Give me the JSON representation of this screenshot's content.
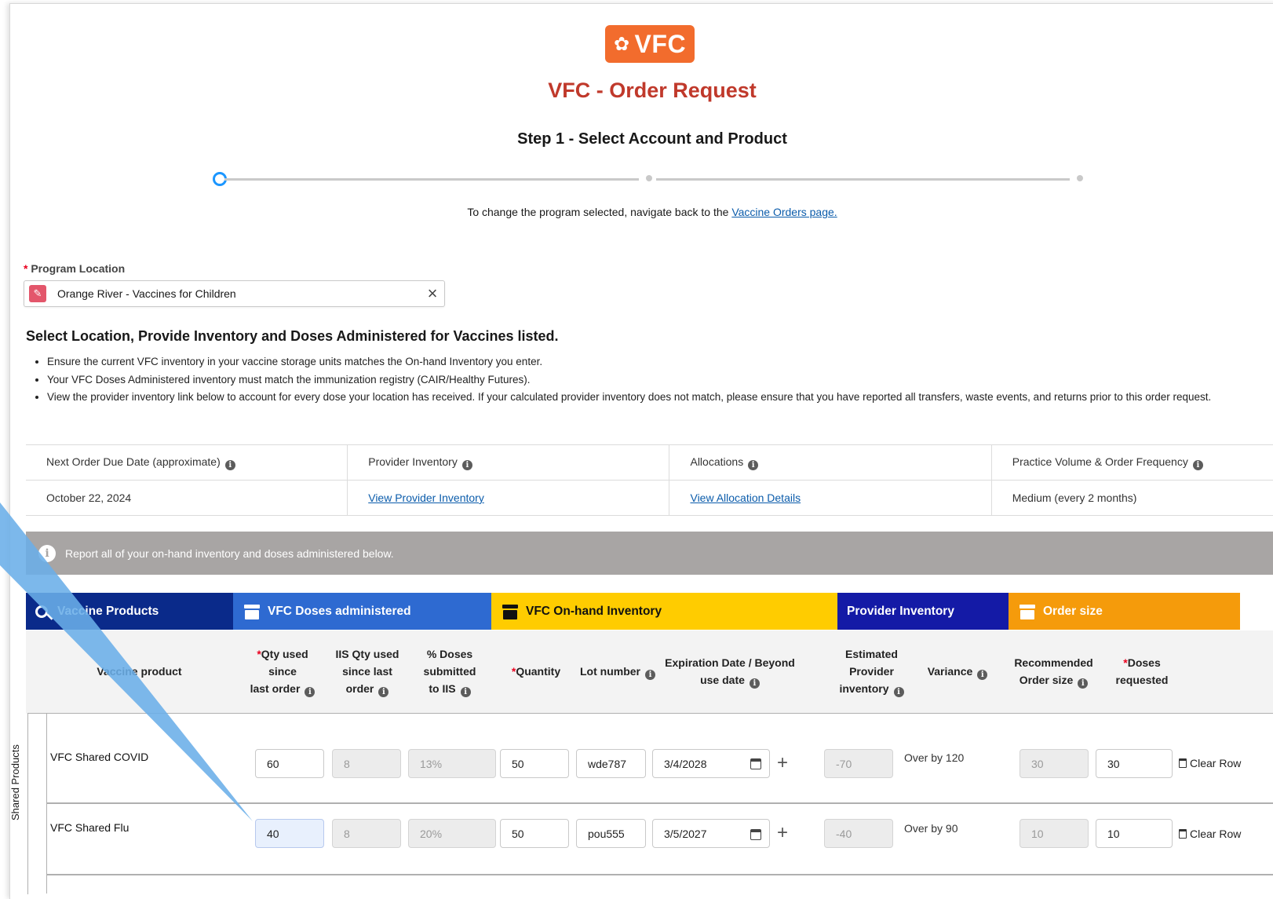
{
  "header": {
    "logo_text": "VFC",
    "title": "VFC - Order Request",
    "step": "Step 1 - Select Account and Product",
    "change_text": "To change the program selected, navigate back to the",
    "change_link": "Vaccine Orders page."
  },
  "program_location": {
    "label": "Program Location",
    "value": "Orange River - Vaccines for Children"
  },
  "instructions": {
    "heading": "Select Location, Provide Inventory and Doses Administered for Vaccines listed.",
    "bullets": [
      "Ensure the current VFC inventory in your vaccine storage units matches the On-hand Inventory you enter.",
      "Your VFC Doses Administered inventory must match the immunization registry (CAIR/Healthy Futures).",
      "View the provider inventory link below to account for every dose your location has received. If your calculated provider inventory does not match, please ensure that you have reported all transfers, waste events, and returns prior to this order request."
    ]
  },
  "info_table": {
    "headers": [
      "Next Order Due Date (approximate)",
      "Provider Inventory",
      "Allocations",
      "Practice Volume & Order Frequency"
    ],
    "values": [
      "October 22, 2024",
      "View Provider Inventory",
      "View Allocation Details",
      "Medium (every 2 months)"
    ]
  },
  "banner": "Report all of your on-hand inventory and doses administered below.",
  "bands": {
    "vaccine_products": "Vaccine Products",
    "doses_administered": "VFC Doses administered",
    "on_hand": "VFC On-hand Inventory",
    "provider_inventory": "Provider Inventory",
    "order_size": "Order size"
  },
  "colors": {
    "band_navy": "#0a2a8a",
    "band_blue": "#2e6ad1",
    "band_yellow": "#ffcc00",
    "band_indigo": "#141aa6",
    "band_orange": "#f59b0b",
    "title_red": "#c0392b",
    "logo_orange": "#f26c2d",
    "arrow_blue": "#6aaee8"
  },
  "columns": {
    "vaccine_product": "Vaccine product",
    "qty_used_1": "Qty used",
    "qty_used_2": "since",
    "qty_used_3": "last order",
    "iis_1": "IIS Qty used",
    "iis_2": "since last",
    "iis_3": "order",
    "pct_1": "% Doses",
    "pct_2": "submitted",
    "pct_3": "to IIS",
    "quantity": "Quantity",
    "lot": "Lot number",
    "exp_1": "Expiration Date / Beyond",
    "exp_2": "use date",
    "est_1": "Estimated",
    "est_2": "Provider",
    "est_3": "inventory",
    "variance": "Variance",
    "rec_1": "Recommended",
    "rec_2": "Order size",
    "doses_1": "Doses",
    "doses_2": "requested"
  },
  "group_label": "Shared Products",
  "rows": [
    {
      "product": "VFC Shared COVID",
      "qty_used": "60",
      "iis_qty": "8",
      "pct": "13%",
      "quantity": "50",
      "lot": "wde787",
      "exp": "3/4/2028",
      "est_inventory": "-70",
      "variance": "Over by 120",
      "recommended": "30",
      "requested": "30",
      "clear": "Clear Row"
    },
    {
      "product": "VFC Shared Flu",
      "qty_used": "40",
      "iis_qty": "8",
      "pct": "20%",
      "quantity": "50",
      "lot": "pou555",
      "exp": "3/5/2027",
      "est_inventory": "-40",
      "variance": "Over by 90",
      "recommended": "10",
      "requested": "10",
      "clear": "Clear Row"
    }
  ]
}
